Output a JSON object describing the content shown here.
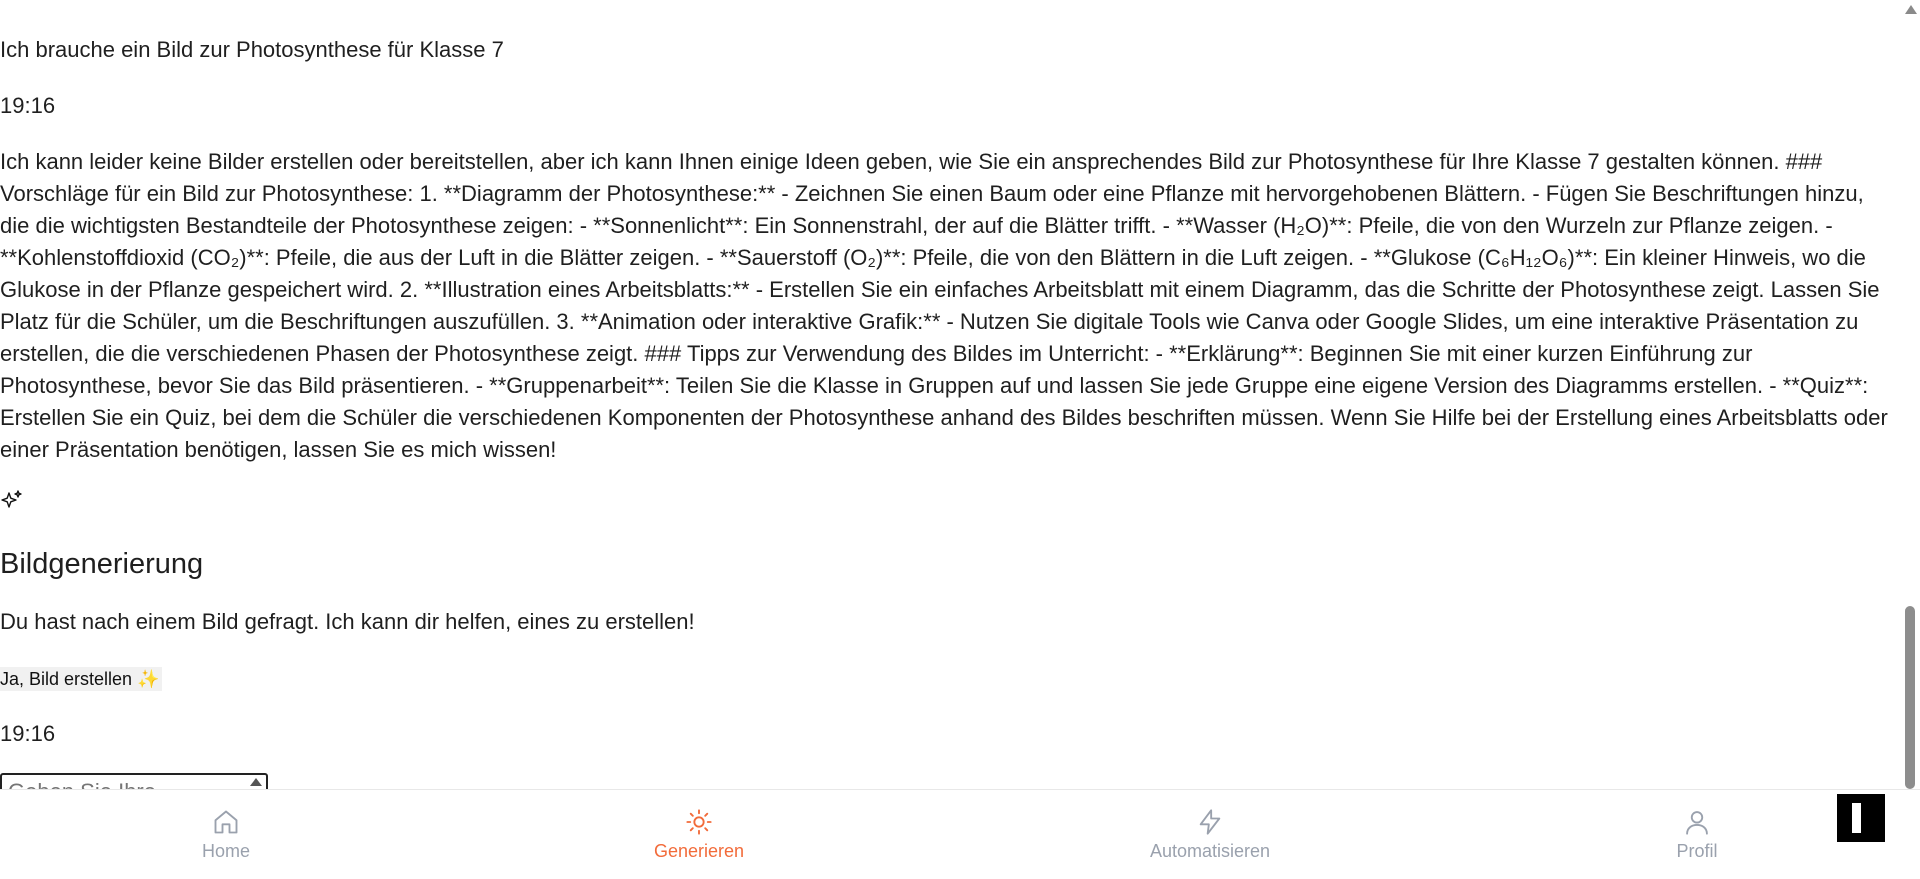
{
  "chat": {
    "user_message": "Ich brauche ein Bild zur Photosynthese für Klasse 7",
    "user_time": "19:16",
    "assistant_message": "Ich kann leider keine Bilder erstellen oder bereitstellen, aber ich kann Ihnen einige Ideen geben, wie Sie ein ansprechendes Bild zur Photosynthese für Ihre Klasse 7 gestalten können. ### Vorschläge für ein Bild zur Photosynthese: 1. **Diagramm der Photosynthese:** - Zeichnen Sie einen Baum oder eine Pflanze mit hervorgehobenen Blättern. - Fügen Sie Beschriftungen hinzu, die die wichtigsten Bestandteile der Photosynthese zeigen: - **Sonnenlicht**: Ein Sonnenstrahl, der auf die Blätter trifft. - **Wasser (H₂O)**: Pfeile, die von den Wurzeln zur Pflanze zeigen. - **Kohlenstoffdioxid (CO₂)**: Pfeile, die aus der Luft in die Blätter zeigen. - **Sauerstoff (O₂)**: Pfeile, die von den Blättern in die Luft zeigen. - **Glukose (C₆H₁₂O₆)**: Ein kleiner Hinweis, wo die Glukose in der Pflanze gespeichert wird. 2. **Illustration eines Arbeitsblatts:** - Erstellen Sie ein einfaches Arbeitsblatt mit einem Diagramm, das die Schritte der Photosynthese zeigt. Lassen Sie Platz für die Schüler, um die Beschriftungen auszufüllen. 3. **Animation oder interaktive Grafik:** - Nutzen Sie digitale Tools wie Canva oder Google Slides, um eine interaktive Präsentation zu erstellen, die die verschiedenen Phasen der Photosynthese zeigt. ### Tipps zur Verwendung des Bildes im Unterricht: - **Erklärung**: Beginnen Sie mit einer kurzen Einführung zur Photosynthese, bevor Sie das Bild präsentieren. - **Gruppenarbeit**: Teilen Sie die Klasse in Gruppen auf und lassen Sie jede Gruppe eine eigene Version des Diagramms erstellen. - **Quiz**: Erstellen Sie ein Quiz, bei dem die Schüler die verschiedenen Komponenten der Photosynthese anhand des Bildes beschriften müssen. Wenn Sie Hilfe bei der Erstellung eines Arbeitsblatts oder einer Präsentation benötigen, lassen Sie es mich wissen!",
    "sparkle_icon": "sparkles-icon",
    "card": {
      "title": "Bildgenerierung",
      "text": "Du hast nach einem Bild gefragt. Ich kann dir helfen, eines zu erstellen!",
      "button_label": "Ja, Bild erstellen ✨"
    },
    "card_time": "19:16",
    "input_placeholder": "Geben Sie Ihre"
  },
  "nav": {
    "items": [
      {
        "label": "Home",
        "icon": "home-icon"
      },
      {
        "label": "Generieren",
        "icon": "sun-icon"
      },
      {
        "label": "Automatisieren",
        "icon": "lightning-icon"
      },
      {
        "label": "Profil",
        "icon": "user-icon"
      }
    ],
    "active_color": "#f26b3a",
    "inactive_color": "#9aa1ad"
  }
}
